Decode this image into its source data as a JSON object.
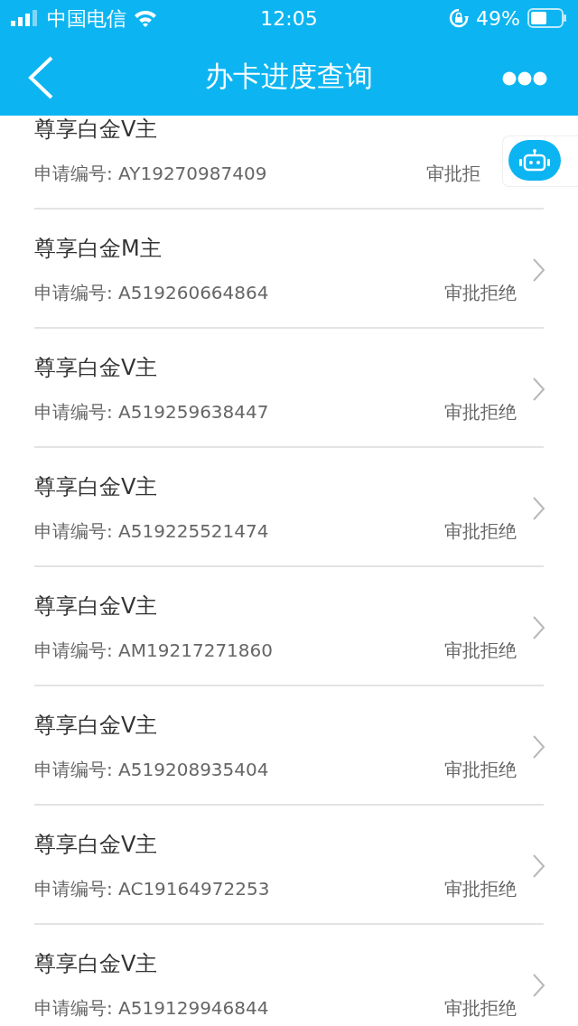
{
  "status_bar": {
    "carrier": "中国电信",
    "time": "12:05",
    "battery": "49%"
  },
  "header": {
    "title": "办卡进度查询"
  },
  "applications": [
    {
      "title": "尊享白金V主",
      "number": "申请编号: AY19270987409",
      "status": "审批拒"
    },
    {
      "title": "尊享白金M主",
      "number": "申请编号: A519260664864",
      "status": "审批拒绝"
    },
    {
      "title": "尊享白金V主",
      "number": "申请编号: A519259638447",
      "status": "审批拒绝"
    },
    {
      "title": "尊享白金V主",
      "number": "申请编号: A519225521474",
      "status": "审批拒绝"
    },
    {
      "title": "尊享白金V主",
      "number": "申请编号: AM19217271860",
      "status": "审批拒绝"
    },
    {
      "title": "尊享白金V主",
      "number": "申请编号: A519208935404",
      "status": "审批拒绝"
    },
    {
      "title": "尊享白金V主",
      "number": "申请编号: AC19164972253",
      "status": "审批拒绝"
    },
    {
      "title": "尊享白金V主",
      "number": "申请编号: A519129946844",
      "status": "审批拒绝"
    }
  ]
}
